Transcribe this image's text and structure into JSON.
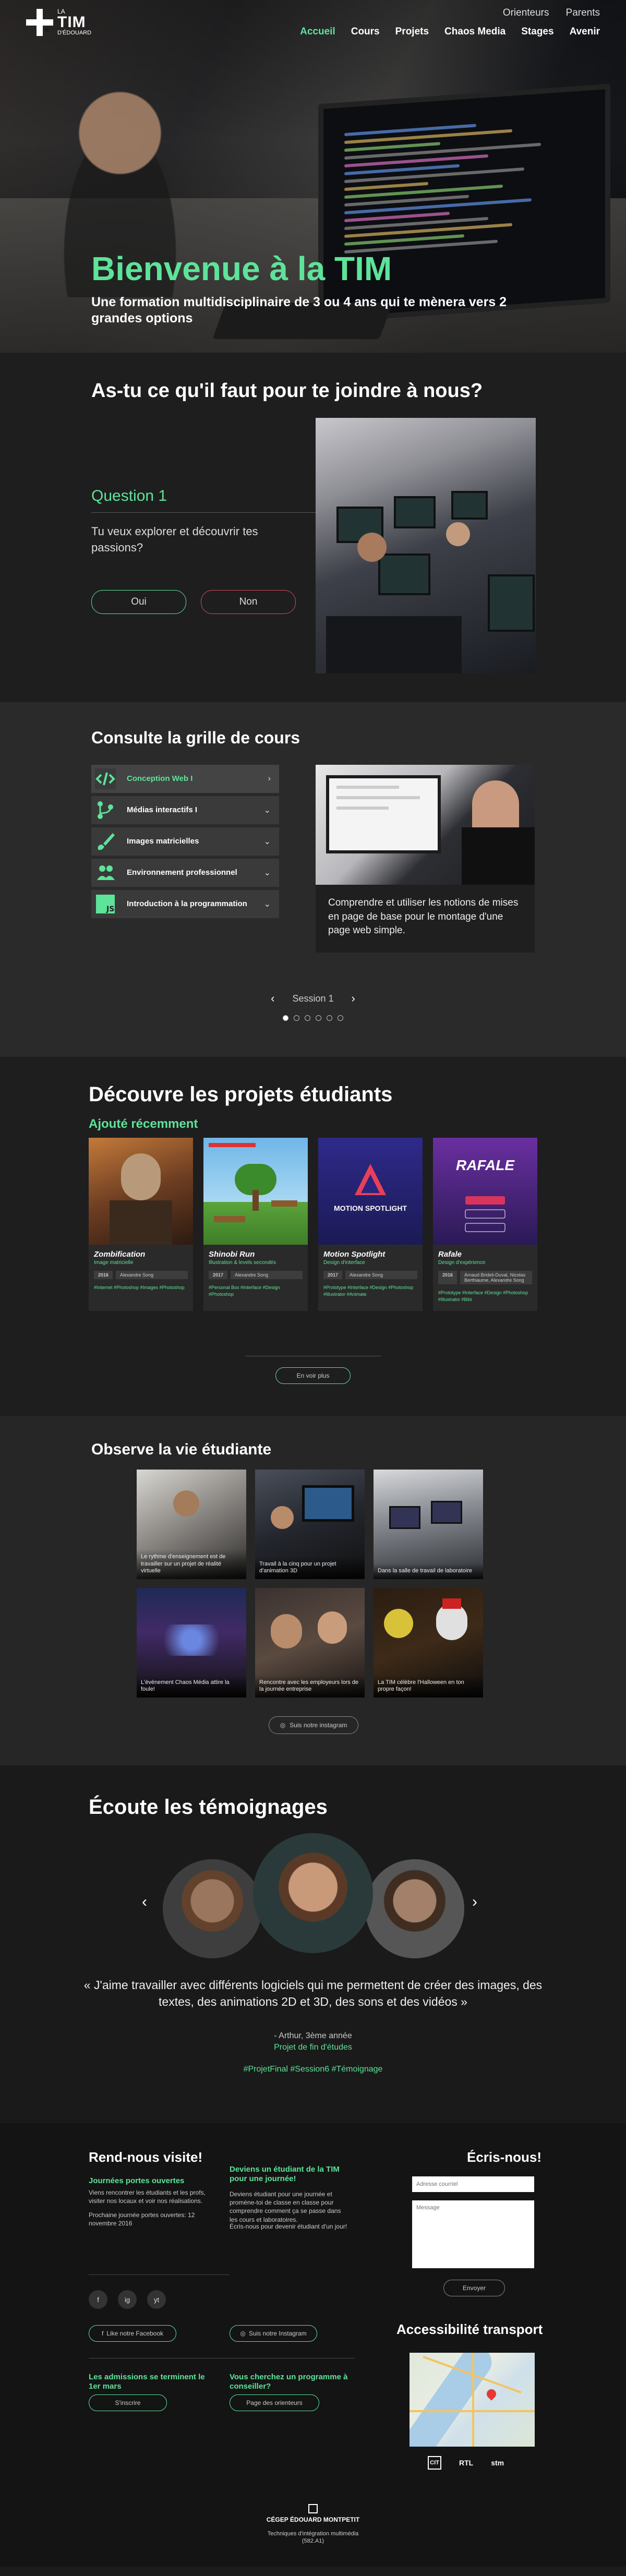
{
  "header": {
    "logo": {
      "la": "LA",
      "tim": "TIM",
      "edouard": "D'ÉDOUARD"
    },
    "top_links": [
      "Orienteurs",
      "Parents"
    ],
    "nav": [
      "Accueil",
      "Cours",
      "Projets",
      "Chaos Media",
      "Stages",
      "Avenir"
    ],
    "active_nav": "Accueil"
  },
  "hero": {
    "title": "Bienvenue à la TIM",
    "subtitle": "Une formation multidisciplinaire de 3 ou 4 ans qui te mènera vers 2 grandes options"
  },
  "quiz": {
    "heading": "As-tu ce qu'il faut pour te joindre à nous?",
    "question_label": "Question 1",
    "question_text": "Tu veux explorer et découvrir tes passions?",
    "yes": "Oui",
    "no": "Non"
  },
  "courses": {
    "heading": "Consulte la grille de cours",
    "items": [
      {
        "label": "Conception Web I",
        "icon": "code-icon",
        "active": true
      },
      {
        "label": "Médias interactifs I",
        "icon": "branch-icon",
        "active": false
      },
      {
        "label": "Images matricielles",
        "icon": "brush-icon",
        "active": false
      },
      {
        "label": "Environnement professionnel",
        "icon": "people-icon",
        "active": false
      },
      {
        "label": "Introduction à la programmation",
        "icon": "js-icon",
        "active": false
      }
    ],
    "description": "Comprendre et utiliser les notions de mises en page de base pour le montage d'une page web simple.",
    "session_label": "Session 1",
    "session_count": 6,
    "session_current": 1
  },
  "projects": {
    "heading": "Découvre les projets étudiants",
    "subheading": "Ajouté récemment",
    "cards": [
      {
        "title": "Zombification",
        "subtitle": "Image matricielle",
        "year": "2016",
        "author": "Alexandre Song",
        "tags": "#Internet #Photoshop #Images #Photoshop",
        "image": "zombie-portrait"
      },
      {
        "title": "Shinobi Run",
        "subtitle": "Illustration & levels secondés",
        "year": "2017",
        "author": "Alexandre Song",
        "tags": "#Personal Box #Interface #Design #Photoshop",
        "image": "pixel-game"
      },
      {
        "title": "Motion Spotlight",
        "subtitle": "Design d'interface",
        "year": "2017",
        "author": "Alexandre Song",
        "tags": "#Prototype #Interface #Design #Photoshop #Illustrator #Animate",
        "image": "motion-logo"
      },
      {
        "title": "Rafale",
        "subtitle": "Design d'expérience",
        "year": "2016",
        "author": "Arnaud Brideli-Duval, Nicolas Berthiaume, Alexandre Song",
        "tags": "#Prototype #Interface #Design #Photoshop #Illustrator #Bibi",
        "image": "rafale-app"
      }
    ],
    "more_label": "En voir plus"
  },
  "student_life": {
    "heading": "Observe la vie étudiante",
    "photos": [
      {
        "caption": "Le rythme d'enseignement est de travailler sur un projet de réalité virtuelle"
      },
      {
        "caption": "Travail à la cinq pour un projet d'animation 3D"
      },
      {
        "caption": "Dans la salle de travail de laboratoire"
      },
      {
        "caption": "L'événement Chaos Média attire la foule!"
      },
      {
        "caption": "Rencontre avec les employeurs lors de la journée entreprise"
      },
      {
        "caption": "La TIM célèbre l'Halloween en ton propre façon!"
      }
    ],
    "follow_label": "Suis notre instagram"
  },
  "testimonials": {
    "heading": "Écoute les témoignages",
    "quote": "« J'aime travailler avec différents logiciels qui me permettent de créer des images, des textes, des animations 2D et 3D, des sons et des vidéos »",
    "author": "- Arthur, 3ème année",
    "program": "Projet de fin d'études",
    "hashtags": "#ProjetFinal #Session6 #Témoignage"
  },
  "footer": {
    "visit_heading": "Rend-nous visite!",
    "open_house_title": "Journées portes ouvertes",
    "open_house_text": "Viens rencontrer les étudiants et les profs, visiter nos locaux et voir nos réalisations.",
    "open_house_next": "Prochaine journée portes ouvertes: 12 novembre 2016",
    "student_day_title": "Deviens un étudiant de la TIM pour une journée!",
    "student_day_text": "Deviens étudiant pour une journée et promène-toi de classe en classe pour comprendre comment ça se passe dans les cours et laboratoires.",
    "student_day_text2": "Écris-nous pour devenir étudiant d'un jour!",
    "social": [
      "f",
      "ig",
      "yt"
    ],
    "facebook_label": "Like notre Facebook",
    "instagram_label": "Suis notre Instagram",
    "admissions_title": "Les admissions se terminent le 1er mars",
    "admissions_button": "S'inscrire",
    "counsel_title": "Vous cherchez un programme à conseiller?",
    "counsel_button": "Page des orienteurs",
    "contact_heading": "Écris-nous!",
    "email_placeholder": "Adresse courriel",
    "message_placeholder": "Message",
    "send_label": "Envoyer",
    "transport_heading": "Accessibilité transport",
    "transit": [
      "CIT",
      "RTL",
      "stm"
    ],
    "college_name": "CÉGEP ÉDOUARD MONTPETIT",
    "program_line": "Techniques d'intégration multimédia",
    "program_code": "(582.A1)"
  }
}
